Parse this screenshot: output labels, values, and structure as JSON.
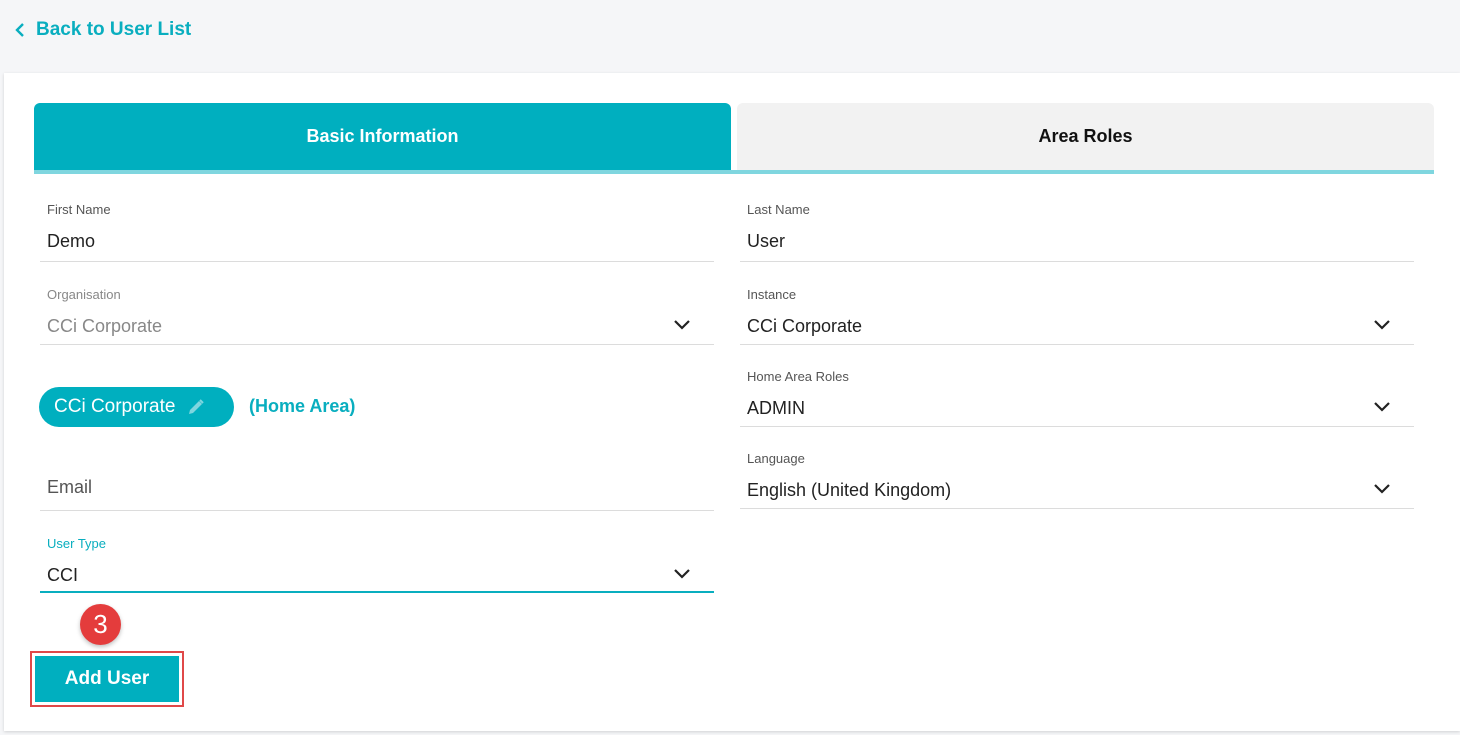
{
  "nav": {
    "back_label": "Back to User List"
  },
  "tabs": [
    {
      "label": "Basic Information",
      "active": true
    },
    {
      "label": "Area Roles",
      "active": false
    }
  ],
  "form": {
    "first_name": {
      "label": "First Name",
      "value": "Demo"
    },
    "last_name": {
      "label": "Last Name",
      "value": "User"
    },
    "organisation": {
      "label": "Organisation",
      "value": "CCi Corporate"
    },
    "instance": {
      "label": "Instance",
      "value": "CCi Corporate"
    },
    "home_area_chip": {
      "label": "CCi Corporate",
      "suffix": "(Home Area)"
    },
    "home_area_roles": {
      "label": "Home Area Roles",
      "value": "ADMIN"
    },
    "email": {
      "placeholder": "Email"
    },
    "language": {
      "label": "Language",
      "value": "English (United Kingdom)"
    },
    "user_type": {
      "label": "User Type",
      "value": "CCI"
    }
  },
  "annotation": {
    "step_number": "3"
  },
  "actions": {
    "add_user_label": "Add User"
  },
  "colors": {
    "accent": "#00afbf",
    "tab_inactive": "#f2f2f2",
    "badge": "#e43c3c"
  }
}
